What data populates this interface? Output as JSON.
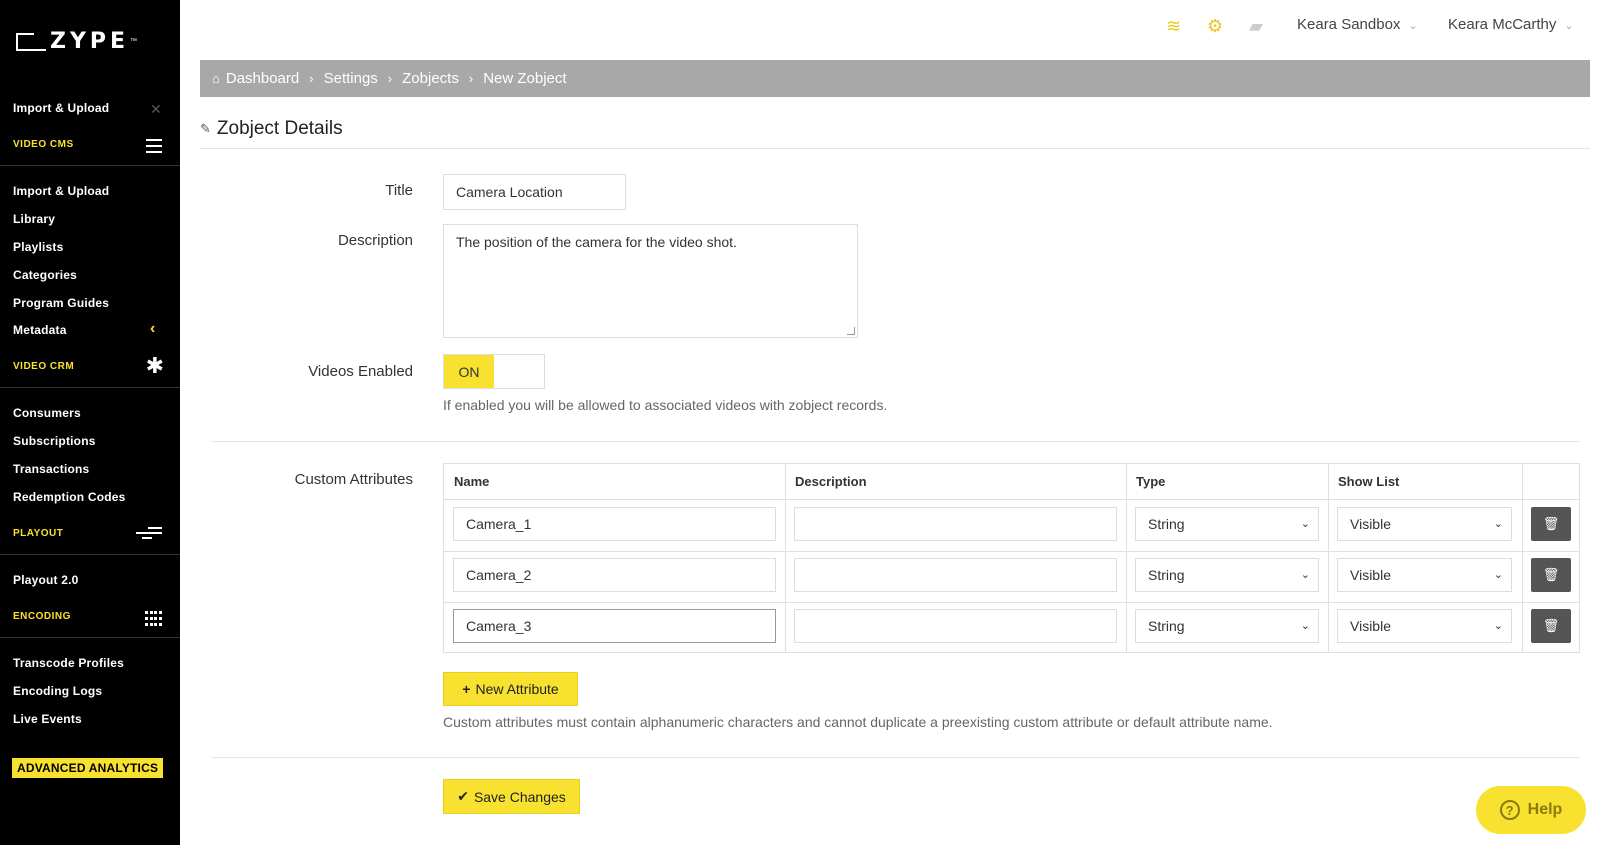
{
  "app": {
    "brand": "ZYPE",
    "tm": "™"
  },
  "sidebar": {
    "top_item": "Import & Upload",
    "sections": [
      {
        "label": "VIDEO CMS",
        "icon": "hamburger-icon"
      },
      {
        "label": "VIDEO CRM",
        "icon": "asterisk-icon"
      },
      {
        "label": "PLAYOUT",
        "icon": "playout-lines-icon"
      },
      {
        "label": "ENCODING",
        "icon": "grid-icon"
      }
    ],
    "cms_items": [
      "Import & Upload",
      "Library",
      "Playlists",
      "Categories",
      "Program Guides",
      "Metadata"
    ],
    "crm_items": [
      "Consumers",
      "Subscriptions",
      "Transactions",
      "Redemption Codes"
    ],
    "playout_items": [
      "Playout 2.0"
    ],
    "encoding_items": [
      "Transcode Profiles",
      "Encoding Logs",
      "Live Events"
    ],
    "analytics_button": "ADVANCED ANALYTICS"
  },
  "topbar": {
    "account": "Keara Sandbox",
    "user": "Keara McCarthy"
  },
  "breadcrumb": [
    "Dashboard",
    "Settings",
    "Zobjects",
    "New Zobject"
  ],
  "section_title": "Zobject Details",
  "form": {
    "title_label": "Title",
    "title_value": "Camera Location",
    "description_label": "Description",
    "description_value": "The position of the camera for the video shot.",
    "videos_enabled_label": "Videos Enabled",
    "videos_enabled_state": "ON",
    "videos_enabled_help": "If enabled you will be allowed to associated videos with zobject records.",
    "custom_attributes_label": "Custom Attributes"
  },
  "attributes_table": {
    "headers": [
      "Name",
      "Description",
      "Type",
      "Show List"
    ],
    "rows": [
      {
        "name": "Camera_1",
        "description": "",
        "type": "String",
        "show_list": "Visible"
      },
      {
        "name": "Camera_2",
        "description": "",
        "type": "String",
        "show_list": "Visible"
      },
      {
        "name": "Camera_3",
        "description": "",
        "type": "String",
        "show_list": "Visible"
      }
    ]
  },
  "new_attribute_button": "New Attribute",
  "attributes_help": "Custom attributes must contain alphanumeric characters and cannot duplicate a preexisting custom attribute or default attribute name.",
  "save_button": "Save Changes",
  "help_button": "Help",
  "colors": {
    "accent": "#f8e12f",
    "sidebar": "#000000",
    "breadcrumb": "#a8a8a8"
  }
}
